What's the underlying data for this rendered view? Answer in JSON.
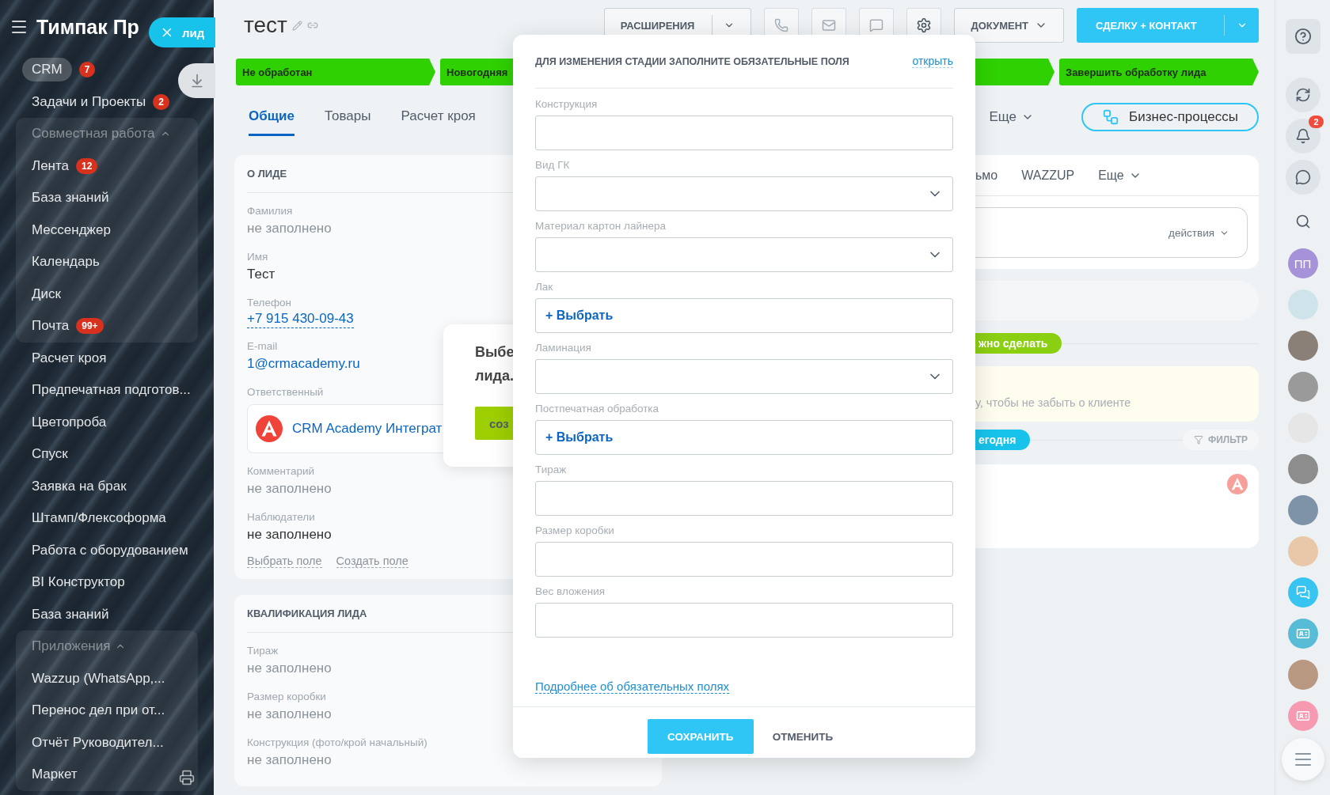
{
  "sidebar": {
    "title": "Тимпак Пр",
    "items": [
      {
        "label": "CRM",
        "badge": "7",
        "selected": true
      },
      {
        "label": "Задачи и Проекты",
        "badge": "2",
        "selected": false
      },
      {
        "label": "Совместная работа",
        "kind": "group",
        "expanded": true,
        "children": [
          {
            "label": "Лента",
            "badge": "12",
            "selected": false
          },
          {
            "label": "База знаний",
            "selected": false
          },
          {
            "label": "Мессенджер",
            "selected": false
          },
          {
            "label": "Календарь",
            "selected": false
          },
          {
            "label": "Диск",
            "selected": false
          },
          {
            "label": "Почта",
            "badge": "99+",
            "selected": false
          }
        ]
      },
      {
        "label": "Расчет кроя",
        "selected": false
      },
      {
        "label": "Предпечатная подготов...",
        "selected": false
      },
      {
        "label": "Цветопроба",
        "selected": false
      },
      {
        "label": "Спуск",
        "selected": false
      },
      {
        "label": "Заявка на брак",
        "selected": false
      },
      {
        "label": "Штамп/Флексоформа",
        "selected": false
      },
      {
        "label": "Работа с оборудованием",
        "selected": false
      },
      {
        "label": "BI Конструктор",
        "selected": false
      },
      {
        "label": "База знаний",
        "selected": false
      },
      {
        "label": "Приложения",
        "kind": "group",
        "expanded": true,
        "children": [
          {
            "label": "Wazzup (WhatsApp,...",
            "selected": false
          },
          {
            "label": "Перенос дел при от...",
            "selected": false
          },
          {
            "label": "Отчёт Руководител...",
            "selected": false
          },
          {
            "label": "Маркет",
            "selected": false
          }
        ]
      }
    ]
  },
  "lead_pill": {
    "label": "лид"
  },
  "header": {
    "title": "тест",
    "extensions_button": "РАСШИРЕНИЯ",
    "document_button": "ДОКУМЕНТ",
    "create_button": "СДЕЛКУ + КОНТАКТ"
  },
  "stages": [
    {
      "label": "Не обработан"
    },
    {
      "label": "Новогодняя"
    },
    {
      "label": "Завершить обработку лида"
    }
  ],
  "tabs": [
    {
      "label": "Общие",
      "selected": true
    },
    {
      "label": "Товары",
      "selected": false
    },
    {
      "label": "Расчет кроя",
      "selected": false
    }
  ],
  "more_tab": "Еще",
  "business_processes_button": "Бизнес-процессы",
  "about_card": {
    "title": "О ЛИДЕ",
    "fields": [
      {
        "label": "Фамилия",
        "value": "не заполнено",
        "kind": "empty"
      },
      {
        "label": "Имя",
        "value": "Тест",
        "kind": "text"
      },
      {
        "label": "Телефон",
        "value": "+7 915 430-09-43",
        "kind": "phone"
      },
      {
        "label": "E-mail",
        "value": "1@crmacademy.ru",
        "kind": "email"
      },
      {
        "label": "Ответственный",
        "value": "CRM Academy Интеграт",
        "kind": "user"
      },
      {
        "label": "Комментарий",
        "value": "не заполнено",
        "kind": "empty"
      },
      {
        "label": "Наблюдатели",
        "value": "не заполнено",
        "kind": "text"
      }
    ],
    "actions": [
      "Выбрать поле",
      "Создать поле"
    ]
  },
  "qualification_card": {
    "title": "КВАЛИФИКАЦИЯ ЛИДА",
    "fields": [
      {
        "label": "Тираж",
        "value": "не заполнено",
        "kind": "empty"
      },
      {
        "label": "Размер коробки",
        "value": "не заполнено",
        "kind": "empty"
      },
      {
        "label": "Конструкция (фото/крой начальный)",
        "value": "не заполнено",
        "kind": "empty"
      }
    ]
  },
  "popup": {
    "lines": [
      "Выбе",
      "лида."
    ],
    "button": "соз"
  },
  "timeline": {
    "tabs": [
      "ьмо",
      "WAZZUP",
      "Еще"
    ],
    "actions_label": "действия",
    "todo_badge": "жно сделать",
    "note": "у, чтобы не забыть о клиенте",
    "today_badge": "егодня",
    "filter_button": "ФИЛЬТР"
  },
  "right_bar": {
    "avatar_initials": "ПП",
    "notifications_badge": "2"
  },
  "modal": {
    "title": "ДЛЯ ИЗМЕНЕНИЯ СТАДИИ ЗАПОЛНИТЕ ОБЯЗАТЕЛЬНЫЕ ПОЛЯ",
    "open_link": "открыть",
    "fields": [
      {
        "label": "Конструкция",
        "kind": "text"
      },
      {
        "label": "Вид ГК",
        "kind": "select"
      },
      {
        "label": "Материал картон лайнера",
        "kind": "select"
      },
      {
        "label": "Лак",
        "kind": "picker",
        "action": "+ Выбрать"
      },
      {
        "label": "Ламинация",
        "kind": "select"
      },
      {
        "label": "Постпечатная обработка",
        "kind": "picker",
        "action": "+ Выбрать"
      },
      {
        "label": "Тираж",
        "kind": "text"
      },
      {
        "label": "Размер коробки",
        "kind": "text"
      },
      {
        "label": "Вес вложения",
        "kind": "text"
      }
    ],
    "help_link": "Подробнее об обязательных полях",
    "save_button": "СОХРАНИТЬ",
    "cancel_button": "ОТМЕНИТЬ"
  }
}
